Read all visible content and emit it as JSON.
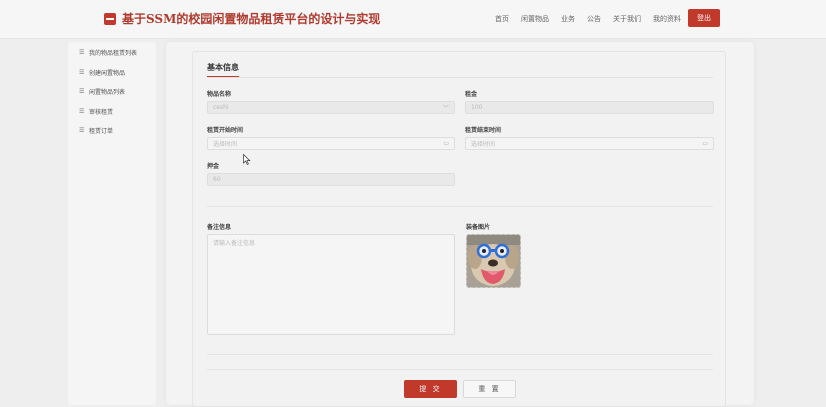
{
  "header": {
    "title": "基于SSM的校园闲置物品租赁平台的设计与实现",
    "nav": [
      "首页",
      "闲置物品",
      "业务",
      "公告",
      "关于我们",
      "我的资料"
    ],
    "logout_label": "登出"
  },
  "sidebar": {
    "items": [
      {
        "icon": "list-icon",
        "label": "我的物品租赁列表"
      },
      {
        "icon": "list-icon",
        "label": "创建闲置物品"
      },
      {
        "icon": "list-icon",
        "label": "闲置物品列表"
      },
      {
        "icon": "list-icon",
        "label": "审核租赁"
      },
      {
        "icon": "list-icon",
        "label": "租赁订单"
      }
    ]
  },
  "form": {
    "section_title": "基本信息",
    "item_name": {
      "label": "物品名称",
      "value": "ceshi"
    },
    "rent": {
      "label": "租金",
      "value": "100"
    },
    "start_time": {
      "label": "租赁开始时间",
      "placeholder": "选择时间"
    },
    "end_time": {
      "label": "租赁结束时间",
      "placeholder": "选择时间"
    },
    "deposit": {
      "label": "押金",
      "value": "60"
    },
    "remarks": {
      "label": "备注信息",
      "placeholder": "请输入备注信息"
    },
    "equipment_image": {
      "label": "装备图片"
    }
  },
  "buttons": {
    "submit": "提 交",
    "reset": "重 置"
  },
  "colors": {
    "accent": "#c0392b"
  }
}
